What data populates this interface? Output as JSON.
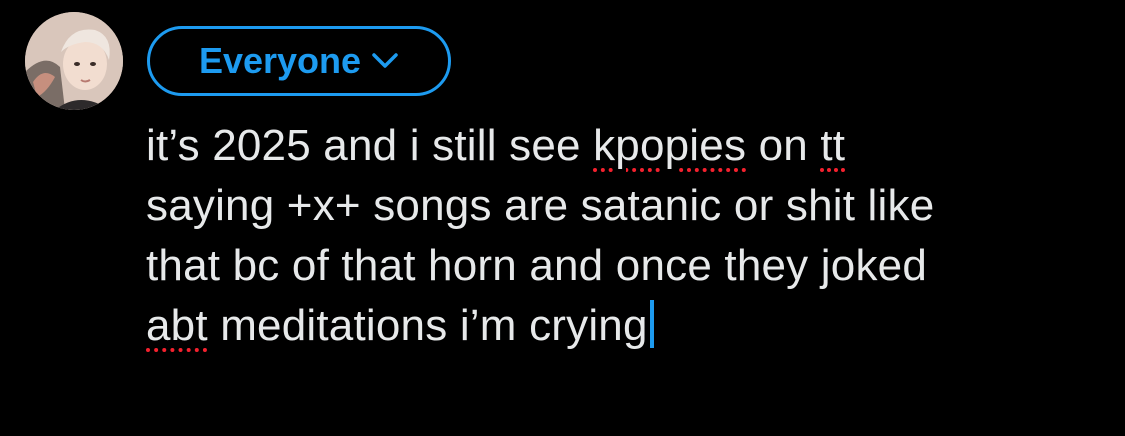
{
  "audience": {
    "label": "Everyone",
    "icon": "chevron-down-icon"
  },
  "avatar": {
    "icon": "avatar-photo"
  },
  "composer": {
    "lines": [
      [
        "it’s 2025 and i still see ",
        "kpopies",
        " on ",
        "tt"
      ],
      [
        "saying +x+ songs are satanic or shit like"
      ],
      [
        "that bc of that horn and once they joked"
      ],
      [
        "abt",
        " meditations i’m crying"
      ]
    ]
  },
  "colors": {
    "background": "#000000",
    "accent": "#1d9bf0",
    "text": "#e7e9ea",
    "spellcheck": "#f4212e"
  }
}
